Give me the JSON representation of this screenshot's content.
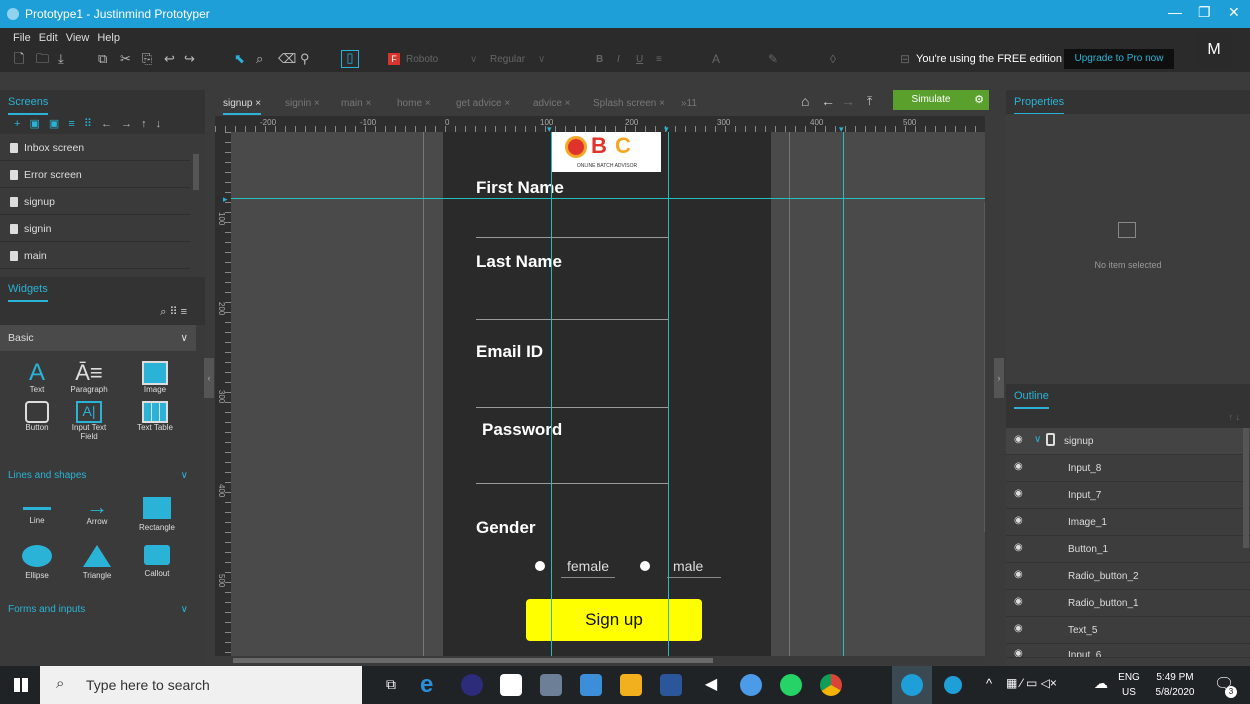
{
  "window": {
    "title": "Prototype1 - Justinmind Prototyper"
  },
  "menu": [
    "File",
    "Edit",
    "View",
    "Help"
  ],
  "toolbar": {
    "font": "Roboto",
    "weight": "Regular",
    "free_text": "You're using the FREE edition",
    "upgrade": "Upgrade to Pro now",
    "avatar": "M"
  },
  "screens": {
    "header": "Screens",
    "items": [
      "Inbox screen",
      "Error screen",
      "signup",
      "signin",
      "main"
    ]
  },
  "widgets": {
    "header": "Widgets",
    "category": "Basic",
    "basic": [
      "Text",
      "Paragraph",
      "Image",
      "Button",
      "Input Text Field",
      "Text Table"
    ],
    "lines_header": "Lines and shapes",
    "shapes": [
      "Line",
      "Arrow",
      "Rectangle",
      "Ellipse",
      "Triangle",
      "Callout"
    ],
    "forms_header": "Forms and inputs"
  },
  "tabs": [
    "signup",
    "signin",
    "main",
    "home",
    "get advice",
    "advice",
    "Splash screen"
  ],
  "tabs_more": "»11",
  "simulate": "Simulate",
  "ruler": {
    "top": [
      "-200",
      "-100",
      "0",
      "100",
      "200",
      "300",
      "400",
      "500"
    ],
    "left": [
      "100",
      "200",
      "300",
      "400",
      "500"
    ]
  },
  "device": {
    "logo_text": "ONLINE BATCH ADVISOR",
    "first_name": "First Name",
    "last_name": "Last Name",
    "email": "Email ID",
    "password": "Password",
    "gender": "Gender",
    "female": "female",
    "male": "male",
    "signup": "Sign up"
  },
  "properties": {
    "header": "Properties",
    "empty": "No item selected"
  },
  "outline": {
    "header": "Outline",
    "root": "signup",
    "items": [
      "Input_8",
      "Input_7",
      "Image_1",
      "Button_1",
      "Radio_button_2",
      "Radio_button_1",
      "Text_5",
      "Input_6"
    ]
  },
  "taskbar": {
    "search": "Type here to search",
    "lang1": "ENG",
    "lang2": "US",
    "time": "5:49 PM",
    "date": "5/8/2020",
    "notif": "3"
  }
}
